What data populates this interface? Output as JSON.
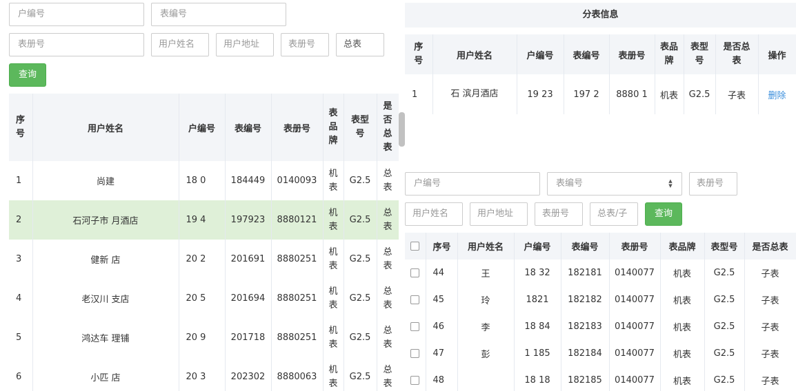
{
  "left_filters": {
    "row1": [
      "户编号",
      "表编号"
    ],
    "row2": [
      "表册号",
      "用户姓名",
      "用户地址",
      "表册号",
      "总表"
    ],
    "query_label": "查询"
  },
  "left_table": {
    "headers": [
      "序号",
      "用户姓名",
      "户编号",
      "表编号",
      "表册号",
      "表品牌",
      "表型号",
      "是否总表"
    ],
    "rows": [
      {
        "no": "1",
        "name": "尚建",
        "account": "18 0",
        "meter_no": "184449",
        "book": "0140093",
        "brand": "机表",
        "model": "G2.5",
        "is_total": "总表"
      },
      {
        "no": "2",
        "name": "石河子市 月酒店",
        "account": "19 4",
        "meter_no": "197923",
        "book": "8880121",
        "brand": "机表",
        "model": "G2.5",
        "is_total": "总表"
      },
      {
        "no": "3",
        "name": "健新 店",
        "account": "20 2",
        "meter_no": "201691",
        "book": "8880251",
        "brand": "机表",
        "model": "G2.5",
        "is_total": "总表"
      },
      {
        "no": "4",
        "name": "老汉川 支店",
        "account": "20 5",
        "meter_no": "201694",
        "book": "8880251",
        "brand": "机表",
        "model": "G2.5",
        "is_total": "总表"
      },
      {
        "no": "5",
        "name": "鸿达车 理铺",
        "account": "20 9",
        "meter_no": "201718",
        "book": "8880251",
        "brand": "机表",
        "model": "G2.5",
        "is_total": "总表"
      },
      {
        "no": "6",
        "name": "小匹 店",
        "account": "20 3",
        "meter_no": "202302",
        "book": "8880063",
        "brand": "机表",
        "model": "G2.5",
        "is_total": "总表"
      }
    ]
  },
  "sub_panel": {
    "title": "分表信息",
    "headers": [
      "序号",
      "用户姓名",
      "户编号",
      "表编号",
      "表册号",
      "表品牌",
      "表型号",
      "是否总表",
      "操作"
    ],
    "rows": [
      {
        "no": "1",
        "name": "石 滨月酒店",
        "account": "19 23",
        "meter_no": "197 2",
        "book": "8880 1",
        "brand": "机表",
        "model": "G2.5",
        "is_total": "子表",
        "action": "删除"
      }
    ]
  },
  "right_filters": {
    "row1": [
      "户编号",
      "表编号",
      "表册号"
    ],
    "row2": [
      "用户姓名",
      "用户地址",
      "表册号",
      "总表/子"
    ],
    "query_label": "查询"
  },
  "right_table": {
    "headers": [
      "序号",
      "用户姓名",
      "户编号",
      "表编号",
      "表册号",
      "表品牌",
      "表型号",
      "是否总表"
    ],
    "rows": [
      {
        "no": "44",
        "name": "王",
        "account": "18 32",
        "meter_no": "182181",
        "book": "0140077",
        "brand": "机表",
        "model": "G2.5",
        "is_total": "子表"
      },
      {
        "no": "45",
        "name": "玲",
        "account": "1821",
        "meter_no": "182182",
        "book": "0140077",
        "brand": "机表",
        "model": "G2.5",
        "is_total": "子表"
      },
      {
        "no": "46",
        "name": "李",
        "account": "18 84",
        "meter_no": "182183",
        "book": "0140077",
        "brand": "机表",
        "model": "G2.5",
        "is_total": "子表"
      },
      {
        "no": "47",
        "name": "彭",
        "account": "1 185",
        "meter_no": "182184",
        "book": "0140077",
        "brand": "机表",
        "model": "G2.5",
        "is_total": "子表"
      },
      {
        "no": "48",
        "name": "",
        "account": "18 18",
        "meter_no": "182185",
        "book": "0140077",
        "brand": "机表",
        "model": "G2.5",
        "is_total": "子表"
      }
    ]
  }
}
